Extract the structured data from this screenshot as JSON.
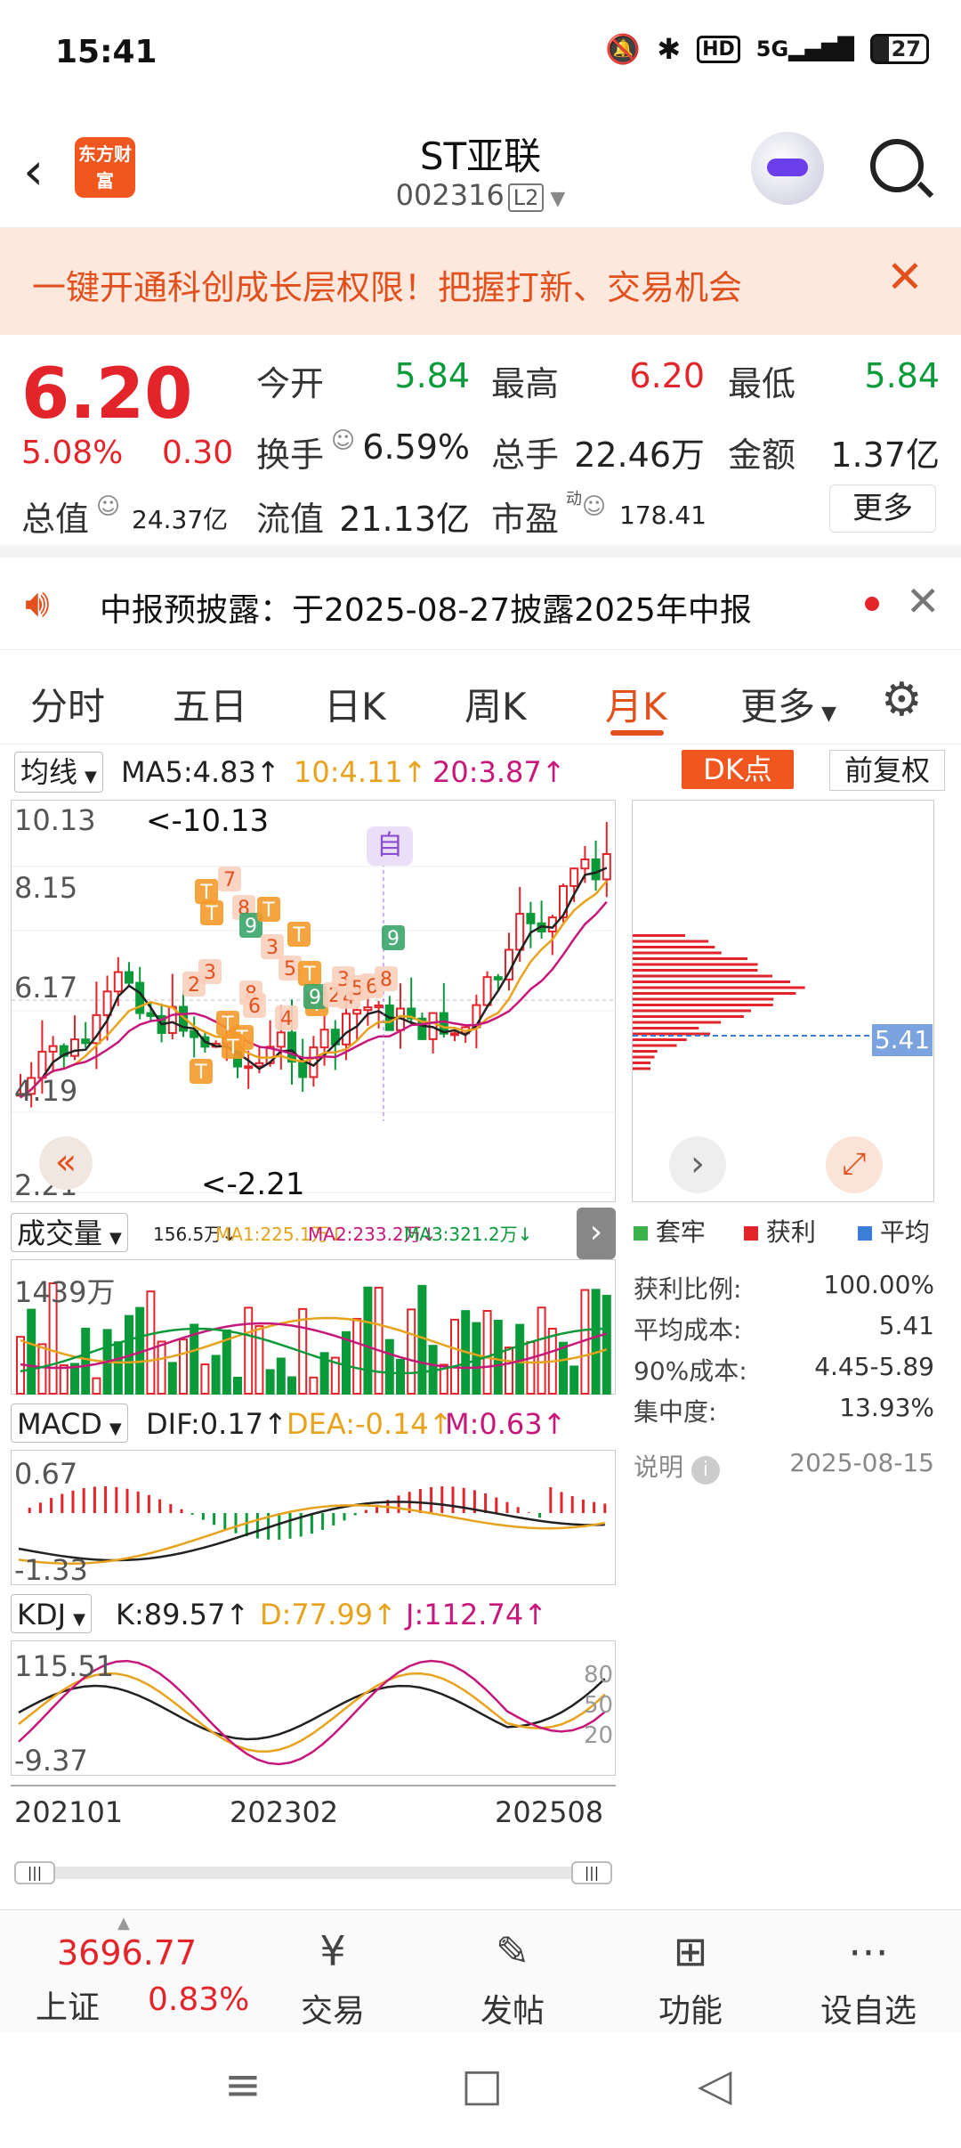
{
  "status_bar": {
    "time": "15:41",
    "battery": "27",
    "signal": "5G"
  },
  "header": {
    "logo": "东方财富",
    "title": "ST亚联",
    "code": "002316",
    "level": "L2"
  },
  "banner": {
    "text": "一键开通科创成长层权限！把握打新、交易机会"
  },
  "quote": {
    "price": "6.20",
    "change_pct": "5.08%",
    "change": "0.30",
    "open_label": "今开",
    "open": "5.84",
    "high_label": "最高",
    "high": "6.20",
    "low_label": "最低",
    "low": "5.84",
    "turnover_label": "换手",
    "turnover": "6.59%",
    "volume_label": "总手",
    "volume": "22.46万",
    "amount_label": "金额",
    "amount": "1.37亿",
    "mcap_label": "总值",
    "mcap": "24.37亿",
    "float_label": "流值",
    "float": "21.13亿",
    "pe_label": "市盈",
    "pe_sup": "动",
    "pe": "178.41",
    "more": "更多"
  },
  "notice": {
    "text": "中报预披露：于2025-08-27披露2025年中报"
  },
  "tabs": [
    "分时",
    "五日",
    "日K",
    "周K",
    "月K",
    "更多"
  ],
  "chart": {
    "ma_select": "均线",
    "ma5": "MA5:4.83",
    "ma10": "10:4.11",
    "ma20": "20:3.87",
    "dk": "DK点",
    "adjust": "前复权",
    "y_ticks": [
      "10.13",
      "8.15",
      "6.17",
      "4.19",
      "2.21"
    ],
    "high_mark": "<-10.13",
    "low_mark": "<-2.21",
    "self_mark": "自",
    "vol_select": "成交量",
    "vol_info": "156.5万",
    "vol_ma1": "MA1:225.1万",
    "vol_ma2": "MA2:233.2万",
    "vol_ma3": "MA3:321.2万",
    "vol_y": "1439万",
    "macd_select": "MACD",
    "dif": "DIF:0.17",
    "dea": "DEA:-0.14",
    "m": "M:0.63",
    "macd_top": "0.67",
    "macd_bot": "-1.33",
    "kdj_select": "KDJ",
    "k": "K:89.57",
    "d": "D:77.99",
    "j": "J:112.74",
    "kdj_top": "115.51",
    "kdj_bot": "-9.37",
    "kdj_levels": [
      "80",
      "50",
      "20"
    ],
    "x_labels": [
      "202101",
      "202302",
      "202508"
    ]
  },
  "chip": {
    "avg": "5.41",
    "legend": [
      "套牢",
      "获利",
      "平均"
    ],
    "stats": [
      {
        "label": "获利比例:",
        "value": "100.00%"
      },
      {
        "label": "平均成本:",
        "value": "5.41"
      },
      {
        "label": "90%成本:",
        "value": "4.45-5.89"
      },
      {
        "label": "集中度:",
        "value": "13.93%"
      }
    ],
    "note_label": "说明",
    "date": "2025-08-15"
  },
  "bottom": {
    "index_value": "3696.77",
    "index_name": "上证",
    "index_pct": "0.83%",
    "items": [
      "交易",
      "发帖",
      "功能",
      "设自选"
    ]
  },
  "colors": {
    "up": "#e3242b",
    "down": "#0a9a3a",
    "accent": "#f0561d"
  }
}
